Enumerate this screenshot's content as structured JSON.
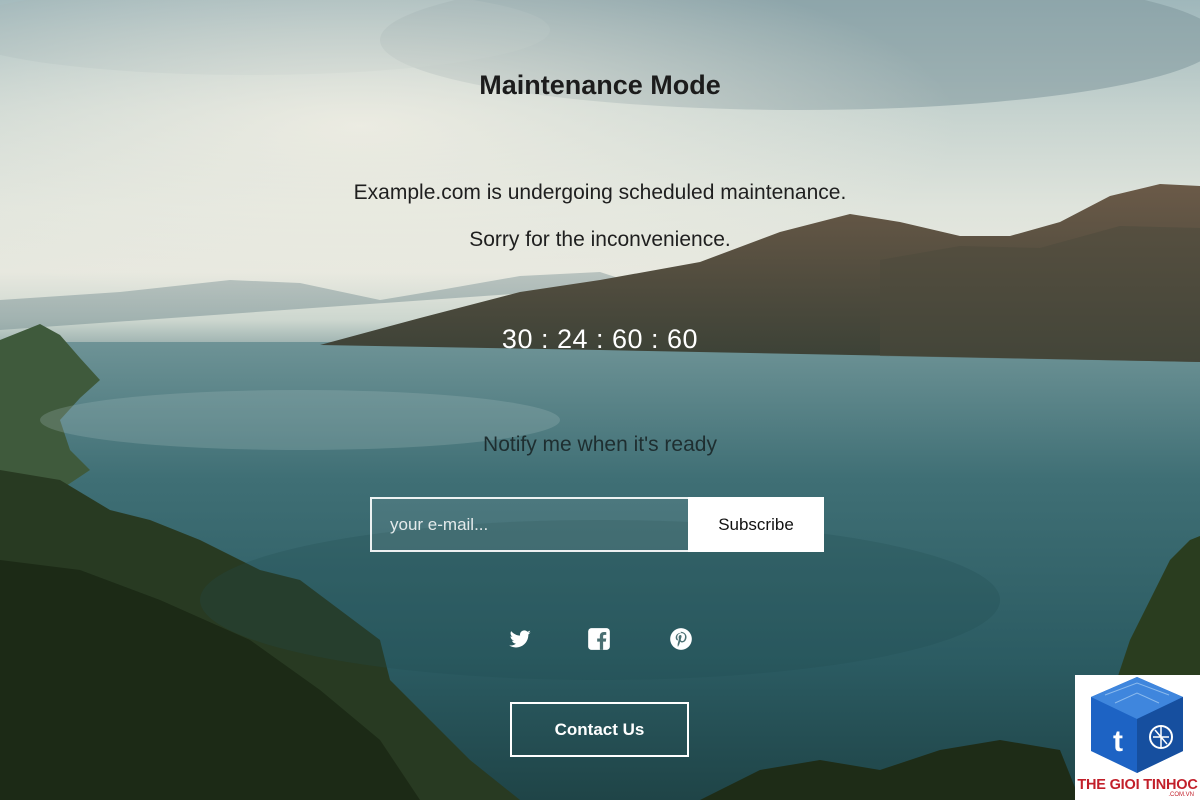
{
  "page": {
    "title": "Maintenance Mode",
    "message_line1": "Example.com is undergoing scheduled maintenance.",
    "message_line2": "Sorry for the inconvenience."
  },
  "countdown": {
    "text": "30 : 24 : 60 : 60"
  },
  "notify": {
    "heading": "Notify me when it's ready",
    "email_placeholder": "your e-mail...",
    "email_value": "",
    "subscribe_label": "Subscribe"
  },
  "social": {
    "items": [
      {
        "icon": "twitter-icon"
      },
      {
        "icon": "facebook-icon"
      },
      {
        "icon": "pinterest-icon"
      }
    ]
  },
  "contact": {
    "label": "Contact Us"
  },
  "watermark": {
    "text": "THE GIOI TINHOC",
    "sub": ".COM.VN",
    "colors": {
      "brand_red": "#c21f2a",
      "cube_blue": "#1d63c4"
    }
  },
  "colors": {
    "heading_text": "#1c1c1c",
    "button_bg": "#ffffff",
    "overlay_text": "#ffffff"
  }
}
